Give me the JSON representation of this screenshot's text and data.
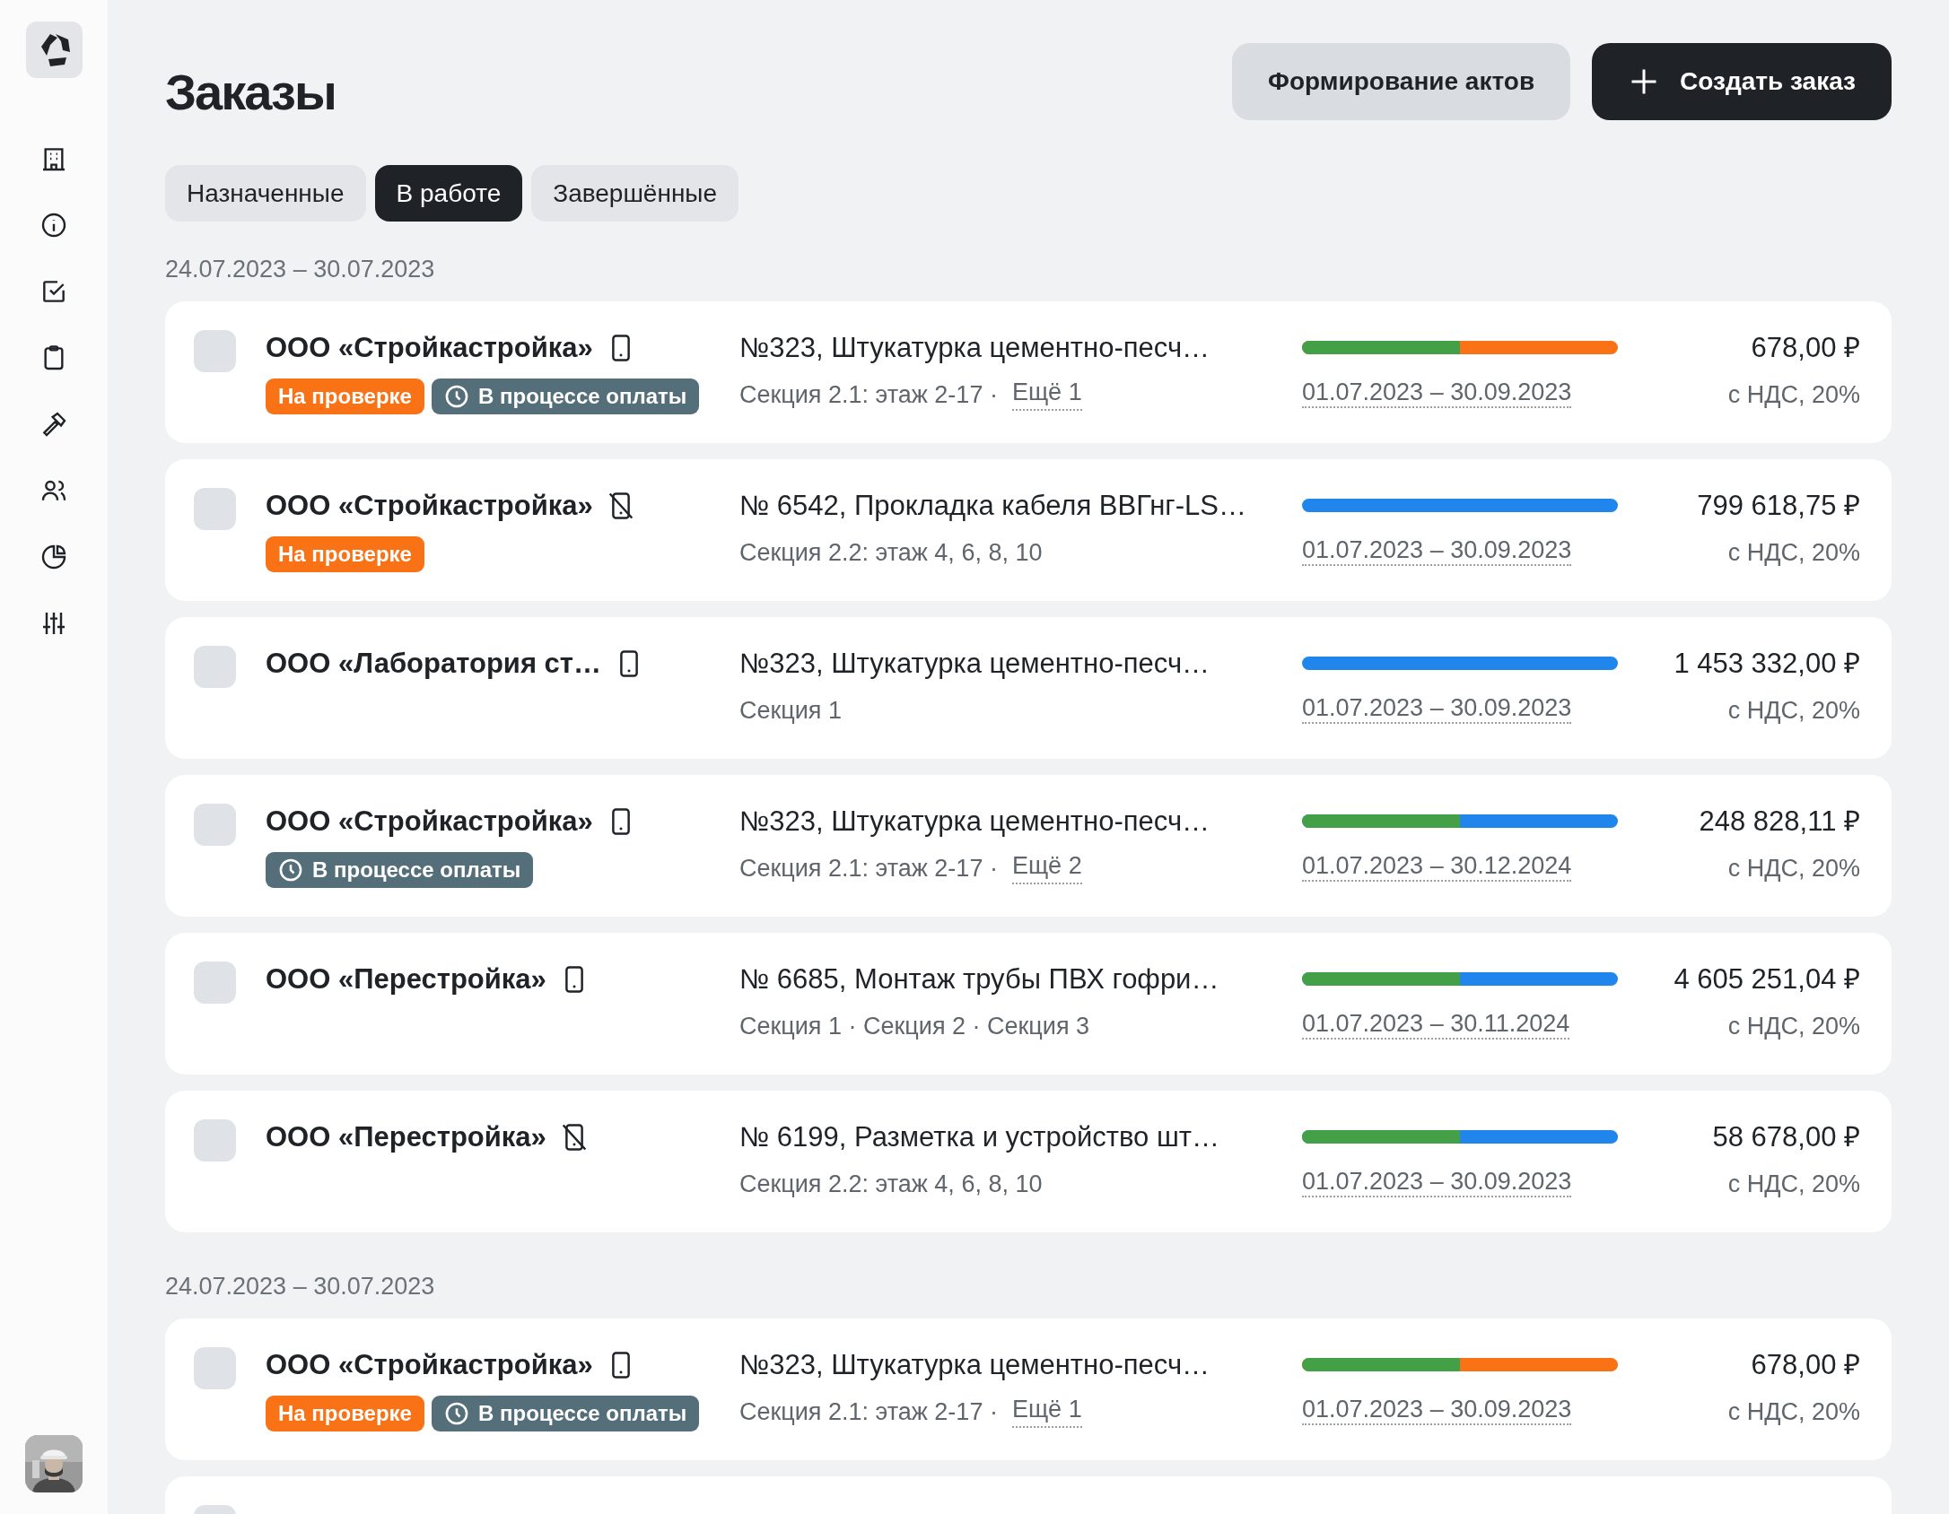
{
  "page": {
    "title": "Заказы"
  },
  "actions": [
    {
      "label": "Формирование актов",
      "kind": "secondary"
    },
    {
      "label": "Создать заказ",
      "kind": "primary"
    }
  ],
  "tabs": [
    {
      "label": "Назначенные",
      "selected": false
    },
    {
      "label": "В работе",
      "selected": true
    },
    {
      "label": "Завершённые",
      "selected": false
    }
  ],
  "groups": [
    {
      "period": "24.07.2023 – 30.07.2023",
      "orders": [
        {
          "checked": false,
          "company": "ООО «Стройкастройка»",
          "mobile_app": true,
          "badges": [
            {
              "kind": "review",
              "label": "На проверке"
            },
            {
              "kind": "payment",
              "label": "В процессе оплаты"
            }
          ],
          "title": "№323, Штукатурка цементно-песч…",
          "sections": "Секция 2.1: этаж 2-17 ·",
          "more": "Ещё 1",
          "progress": {
            "level": 0.5,
            "color": "#f97316"
          },
          "dates": "01.07.2023 – 30.09.2023",
          "amount": "678,00 ₽",
          "tax": "с НДС, 20%"
        },
        {
          "checked": false,
          "company": "ООО «Стройкастройка»",
          "mobile_app": false,
          "badges": [
            {
              "kind": "review",
              "label": "На проверке"
            }
          ],
          "title": "№ 6542, Прокладка кабеля ВВГнг-LS…",
          "sections": "Секция 2.2: этаж 4, 6, 8, 10",
          "progress": {
            "color": "#2186eb"
          },
          "dates": "01.07.2023 – 30.09.2023",
          "amount": "799 618,75 ₽",
          "tax": "с НДС, 20%"
        },
        {
          "checked": false,
          "company": "ООО «Лаборатория ст…",
          "mobile_app": true,
          "title": "№323, Штукатурка цементно-песч…",
          "sections": "Секция 1",
          "progress": {
            "color": "#2186eb"
          },
          "dates": "01.07.2023 – 30.09.2023",
          "amount": "1 453 332,00 ₽",
          "tax": "с НДС, 20%"
        },
        {
          "checked": false,
          "company": "ООО «Стройкастройка»",
          "mobile_app": true,
          "badges": [
            {
              "kind": "payment",
              "label": "В процессе оплаты"
            }
          ],
          "title": "№323, Штукатурка цементно-песч…",
          "sections": "Секция 2.1: этаж 2-17 ·",
          "more": "Ещё 2",
          "progress": {
            "level": 0.5,
            "color": "#2186eb"
          },
          "dates": "01.07.2023 – 30.12.2024",
          "amount": "248 828,11 ₽",
          "tax": "с НДС, 20%"
        },
        {
          "checked": false,
          "company": "ООО «Перестройка»",
          "mobile_app": true,
          "title": "№ 6685, Монтаж трубы ПВХ гофри…",
          "sections": "Секция 1 · Секция 2 · Секция 3",
          "progress": {
            "level": 0.5,
            "color": "#2186eb"
          },
          "dates": "01.07.2023 – 30.11.2024",
          "amount": "4 605 251,04 ₽",
          "tax": "с НДС, 20%"
        },
        {
          "checked": false,
          "company": "ООО «Перестройка»",
          "mobile_app": false,
          "title": "№ 6199, Разметка и устройство шт…",
          "sections": "Секция 2.2: этаж 4, 6, 8, 10",
          "progress": {
            "level": 0.5,
            "color": "#2186eb"
          },
          "dates": "01.07.2023 – 30.09.2023",
          "amount": "58 678,00 ₽",
          "tax": "с НДС, 20%"
        }
      ]
    },
    {
      "period": "24.07.2023 – 30.07.2023",
      "orders": [
        {
          "checked": false,
          "company": "ООО «Стройкастройка»",
          "mobile_app": true,
          "badges": [
            {
              "kind": "review",
              "label": "На проверке"
            },
            {
              "kind": "payment",
              "label": "В процессе оплаты"
            }
          ],
          "title": "№323, Штукатурка цементно-песч…",
          "sections": "Секция 2.1: этаж 2-17 ·",
          "more": "Ещё 1",
          "progress": {
            "level": 0.5,
            "color": "#f97316"
          },
          "dates": "01.07.2023 – 30.09.2023",
          "amount": "678,00 ₽",
          "tax": "с НДС, 20%"
        },
        {
          "checked": false
        }
      ]
    }
  ]
}
